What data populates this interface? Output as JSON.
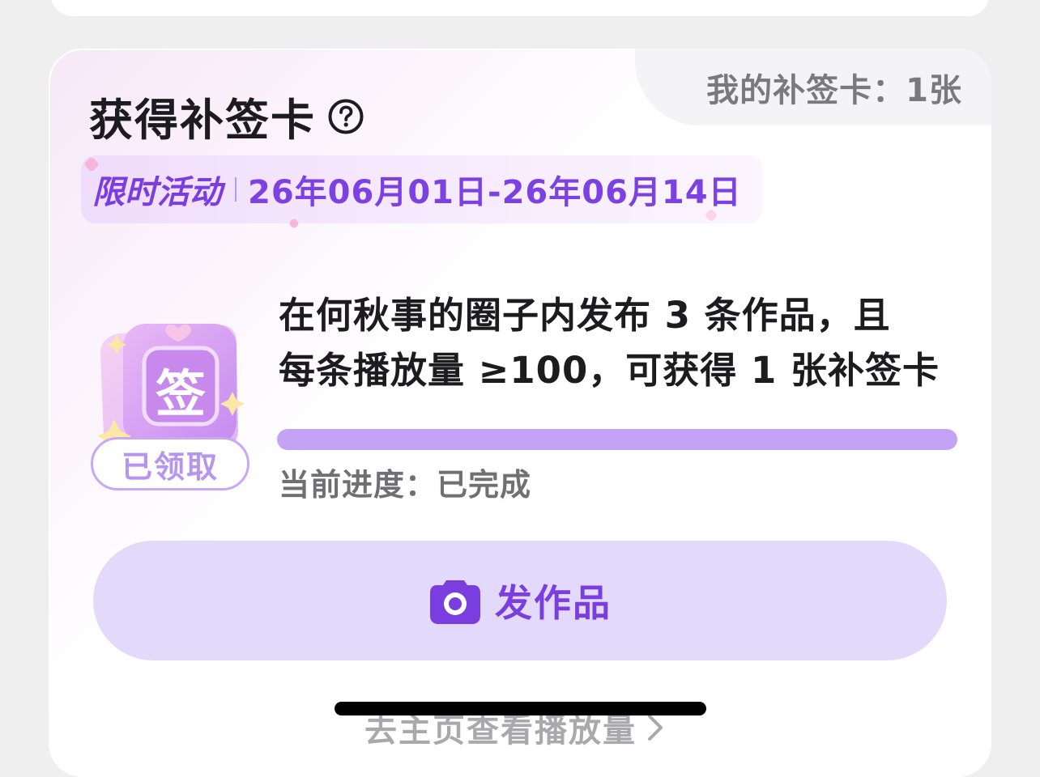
{
  "header": {
    "title": "获得补签卡",
    "my_cards": "我的补签卡：1张"
  },
  "activity": {
    "label": "限时活动",
    "date_range": "26年06月01日-26年06月14日"
  },
  "badge": {
    "glyph": "签",
    "status": "已领取"
  },
  "task": {
    "line1": "在何秋事的圈子内发布 3 条作品，且",
    "line2": "每条播放量 ≥100，可获得 1 张补签卡",
    "progress_fraction": 1.0,
    "progress_text": "当前进度：已完成"
  },
  "actions": {
    "post_label": "发作品",
    "view_link": "去主页查看播放量"
  },
  "colors": {
    "accent": "#7a3ee0",
    "progress_fill": "#c4a3f6",
    "button_bg": "#e3dafb"
  },
  "icons": {
    "help": "question-circle-icon",
    "camera": "camera-icon",
    "chevron": "chevron-right-icon"
  }
}
